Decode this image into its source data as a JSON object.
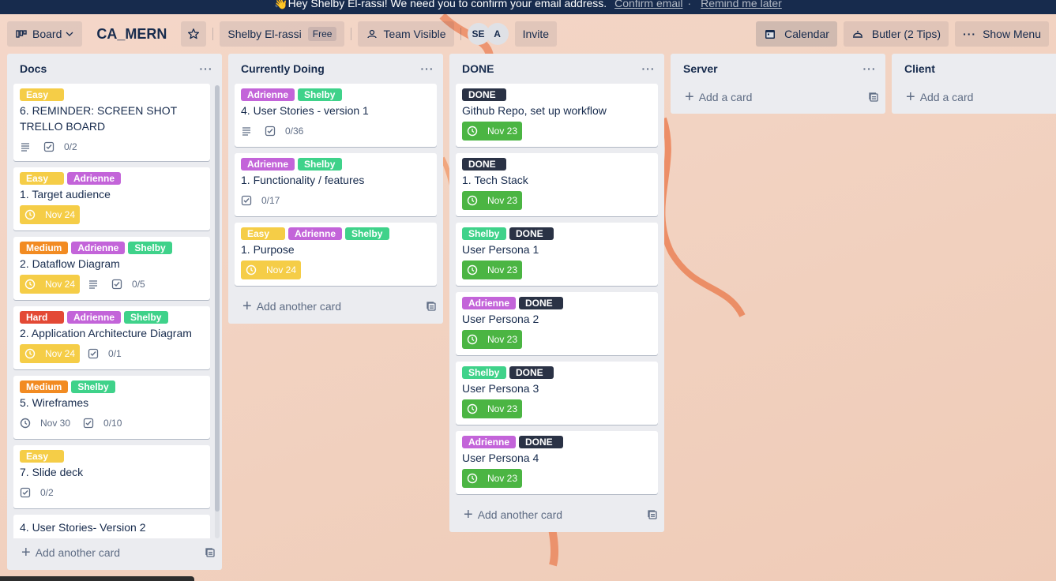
{
  "banner": {
    "message": "👋Hey Shelby El-rassi! We need you to confirm your email address.",
    "confirm_link": "Confirm email",
    "separator": "·",
    "remind_link": "Remind me later"
  },
  "header": {
    "board_menu_label": "Board",
    "board_title": "CA_MERN",
    "workspace_label": "Shelby El-rassi",
    "plan_badge": "Free",
    "visibility_label": "Team Visible",
    "members": [
      {
        "initials": "SE"
      },
      {
        "initials": "A"
      }
    ],
    "invite_label": "Invite",
    "calendar_label": "Calendar",
    "butler_label": "Butler (2 Tips)",
    "show_menu_label": "Show Menu",
    "list_menu_glyph": "···"
  },
  "colors": {
    "easy": "#f5cd47",
    "medium": "#f28b22",
    "hard": "#e34935",
    "adrienne": "#c364d9",
    "shelby": "#3fd28a",
    "done": "#2a3245",
    "due_soon": "#f5cd47",
    "complete": "#4bb543"
  },
  "lists": [
    {
      "title": "Docs",
      "add_label": "Add another card",
      "cards": [
        {
          "labels": [
            {
              "text": "Easy",
              "kind": "easy"
            }
          ],
          "title": "6. REMINDER: SCREEN SHOT TRELLO BOARD",
          "description": true,
          "checklist": "0/2"
        },
        {
          "labels": [
            {
              "text": "Easy",
              "kind": "easy"
            },
            {
              "text": "Adrienne",
              "kind": "adrienne"
            }
          ],
          "title": "1. Target audience",
          "due": {
            "text": "Nov 24",
            "style": "yellow"
          }
        },
        {
          "labels": [
            {
              "text": "Medium",
              "kind": "medium"
            },
            {
              "text": "Adrienne",
              "kind": "adrienne"
            },
            {
              "text": "Shelby",
              "kind": "shelby"
            }
          ],
          "title": "2. Dataflow Diagram",
          "due": {
            "text": "Nov 24",
            "style": "yellow"
          },
          "description": true,
          "checklist": "0/5"
        },
        {
          "labels": [
            {
              "text": "Hard",
              "kind": "hard"
            },
            {
              "text": "Adrienne",
              "kind": "adrienne"
            },
            {
              "text": "Shelby",
              "kind": "shelby"
            }
          ],
          "title": "2. Application Architecture Diagram",
          "due": {
            "text": "Nov 24",
            "style": "yellow"
          },
          "checklist": "0/1"
        },
        {
          "labels": [
            {
              "text": "Medium",
              "kind": "medium"
            },
            {
              "text": "Shelby",
              "kind": "shelby"
            }
          ],
          "title": "5. Wireframes",
          "due": {
            "text": "Nov 30",
            "style": "plain"
          },
          "checklist": "0/10"
        },
        {
          "labels": [
            {
              "text": "Easy",
              "kind": "easy"
            }
          ],
          "title": "7. Slide deck",
          "checklist": "0/2"
        },
        {
          "labels": [],
          "title": "4. User Stories- Version 2"
        }
      ]
    },
    {
      "title": "Currently Doing",
      "add_label": "Add another card",
      "cards": [
        {
          "labels": [
            {
              "text": "Adrienne",
              "kind": "adrienne"
            },
            {
              "text": "Shelby",
              "kind": "shelby"
            }
          ],
          "title": "4. User Stories - version 1",
          "description": true,
          "checklist": "0/36"
        },
        {
          "labels": [
            {
              "text": "Adrienne",
              "kind": "adrienne"
            },
            {
              "text": "Shelby",
              "kind": "shelby"
            }
          ],
          "title": "1. Functionality / features",
          "checklist": "0/17"
        },
        {
          "labels": [
            {
              "text": "Easy",
              "kind": "easy"
            },
            {
              "text": "Adrienne",
              "kind": "adrienne"
            },
            {
              "text": "Shelby",
              "kind": "shelby"
            }
          ],
          "title": "1. Purpose",
          "due": {
            "text": "Nov 24",
            "style": "yellow"
          }
        }
      ]
    },
    {
      "title": "DONE",
      "add_label": "Add another card",
      "cards": [
        {
          "labels": [
            {
              "text": "DONE",
              "kind": "done"
            }
          ],
          "title": "Github Repo, set up workflow",
          "due": {
            "text": "Nov 23",
            "style": "green"
          }
        },
        {
          "labels": [
            {
              "text": "DONE",
              "kind": "done"
            }
          ],
          "title": "1. Tech Stack",
          "due": {
            "text": "Nov 23",
            "style": "green"
          }
        },
        {
          "labels": [
            {
              "text": "Shelby",
              "kind": "shelby"
            },
            {
              "text": "DONE",
              "kind": "done"
            }
          ],
          "title": "User Persona 1",
          "due": {
            "text": "Nov 23",
            "style": "green"
          }
        },
        {
          "labels": [
            {
              "text": "Adrienne",
              "kind": "adrienne"
            },
            {
              "text": "DONE",
              "kind": "done"
            }
          ],
          "title": "User Persona 2",
          "due": {
            "text": "Nov 23",
            "style": "green"
          }
        },
        {
          "labels": [
            {
              "text": "Shelby",
              "kind": "shelby"
            },
            {
              "text": "DONE",
              "kind": "done"
            }
          ],
          "title": "User Persona 3",
          "due": {
            "text": "Nov 23",
            "style": "green"
          }
        },
        {
          "labels": [
            {
              "text": "Adrienne",
              "kind": "adrienne"
            },
            {
              "text": "DONE",
              "kind": "done"
            }
          ],
          "title": "User Persona 4",
          "due": {
            "text": "Nov 23",
            "style": "green"
          }
        }
      ]
    },
    {
      "title": "Server",
      "add_label": "Add a card",
      "cards": []
    },
    {
      "title": "Client",
      "add_label": "Add a card",
      "cards": []
    }
  ]
}
